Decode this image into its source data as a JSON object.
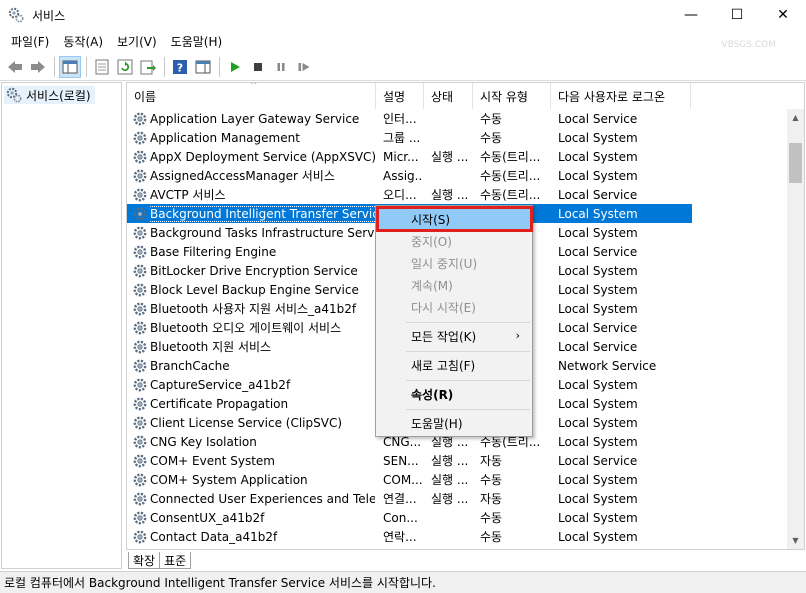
{
  "window": {
    "title": "서비스",
    "min": "—",
    "max": "☐",
    "close": "✕",
    "watermark": "VBSGS.COM"
  },
  "menu": [
    "파일(F)",
    "동작(A)",
    "보기(V)",
    "도움말(H)"
  ],
  "tree": {
    "root_label": "서비스(로컬)"
  },
  "columns": {
    "name": "이름",
    "desc": "설명",
    "status": "상태",
    "type": "시작 유형",
    "logon": "다음 사용자로 로그온"
  },
  "services": [
    {
      "name": "Application Layer Gateway Service",
      "desc": "인터...",
      "status": "",
      "type": "수동",
      "logon": "Local Service"
    },
    {
      "name": "Application Management",
      "desc": "그룹 ...",
      "status": "",
      "type": "수동",
      "logon": "Local System"
    },
    {
      "name": "AppX Deployment Service (AppXSVC)",
      "desc": "Micr...",
      "status": "실행 ...",
      "type": "수동(트리...",
      "logon": "Local System"
    },
    {
      "name": "AssignedAccessManager 서비스",
      "desc": "Assig...",
      "status": "",
      "type": "수동(트리...",
      "logon": "Local System"
    },
    {
      "name": "AVCTP 서비스",
      "desc": "오디...",
      "status": "실행 ...",
      "type": "수동(트리...",
      "logon": "Local Service"
    },
    {
      "name": "Background Intelligent Transfer Service",
      "desc": "",
      "status": "",
      "type": "",
      "logon": "Local System"
    },
    {
      "name": "Background Tasks Infrastructure Service",
      "desc": "",
      "status": "",
      "type": "",
      "logon": "Local System"
    },
    {
      "name": "Base Filtering Engine",
      "desc": "",
      "status": "",
      "type": "",
      "logon": "Local Service"
    },
    {
      "name": "BitLocker Drive Encryption Service",
      "desc": "",
      "status": "",
      "type": "",
      "logon": "Local System"
    },
    {
      "name": "Block Level Backup Engine Service",
      "desc": "",
      "status": "",
      "type": "",
      "logon": "Local System"
    },
    {
      "name": "Bluetooth 사용자 지원 서비스_a41b2f",
      "desc": "",
      "status": "",
      "type": "",
      "logon": "Local System"
    },
    {
      "name": "Bluetooth 오디오 게이트웨이 서비스",
      "desc": "",
      "status": "",
      "type": "",
      "logon": "Local Service"
    },
    {
      "name": "Bluetooth 지원 서비스",
      "desc": "",
      "status": "",
      "type": "",
      "logon": "Local Service"
    },
    {
      "name": "BranchCache",
      "desc": "",
      "status": "",
      "type": "",
      "logon": "Network Service"
    },
    {
      "name": "CaptureService_a41b2f",
      "desc": "",
      "status": "",
      "type": "",
      "logon": "Local System"
    },
    {
      "name": "Certificate Propagation",
      "desc": "",
      "status": "",
      "type": "",
      "logon": "Local System"
    },
    {
      "name": "Client License Service (ClipSVC)",
      "desc": "",
      "status": "",
      "type": "",
      "logon": "Local System"
    },
    {
      "name": "CNG Key Isolation",
      "desc": "CNG...",
      "status": "실행 ...",
      "type": "수동(트리...",
      "logon": "Local System"
    },
    {
      "name": "COM+ Event System",
      "desc": "SEN...",
      "status": "실행 ...",
      "type": "자동",
      "logon": "Local Service"
    },
    {
      "name": "COM+ System Application",
      "desc": "COM...",
      "status": "실행 ...",
      "type": "수동",
      "logon": "Local System"
    },
    {
      "name": "Connected User Experiences and Telem...",
      "desc": "연결...",
      "status": "실행 ...",
      "type": "자동",
      "logon": "Local System"
    },
    {
      "name": "ConsentUX_a41b2f",
      "desc": "Con...",
      "status": "",
      "type": "수동",
      "logon": "Local System"
    },
    {
      "name": "Contact Data_a41b2f",
      "desc": "연락...",
      "status": "",
      "type": "수동",
      "logon": "Local System"
    }
  ],
  "selected_index": 5,
  "context_menu": {
    "start": "시작(S)",
    "stop": "중지(O)",
    "pause": "일시 중지(U)",
    "resume": "계속(M)",
    "restart": "다시 시작(E)",
    "all_tasks": "모든 작업(K)",
    "refresh": "새로 고침(F)",
    "properties": "속성(R)",
    "help": "도움말(H)"
  },
  "tabs": [
    "확장",
    "표준"
  ],
  "status_text": "로컬 컴퓨터에서 Background Intelligent Transfer Service 서비스를 시작합니다.",
  "colors": {
    "selection": "#0078d7",
    "menu_hover": "#91c9f7",
    "highlight_border": "#e0201c"
  }
}
